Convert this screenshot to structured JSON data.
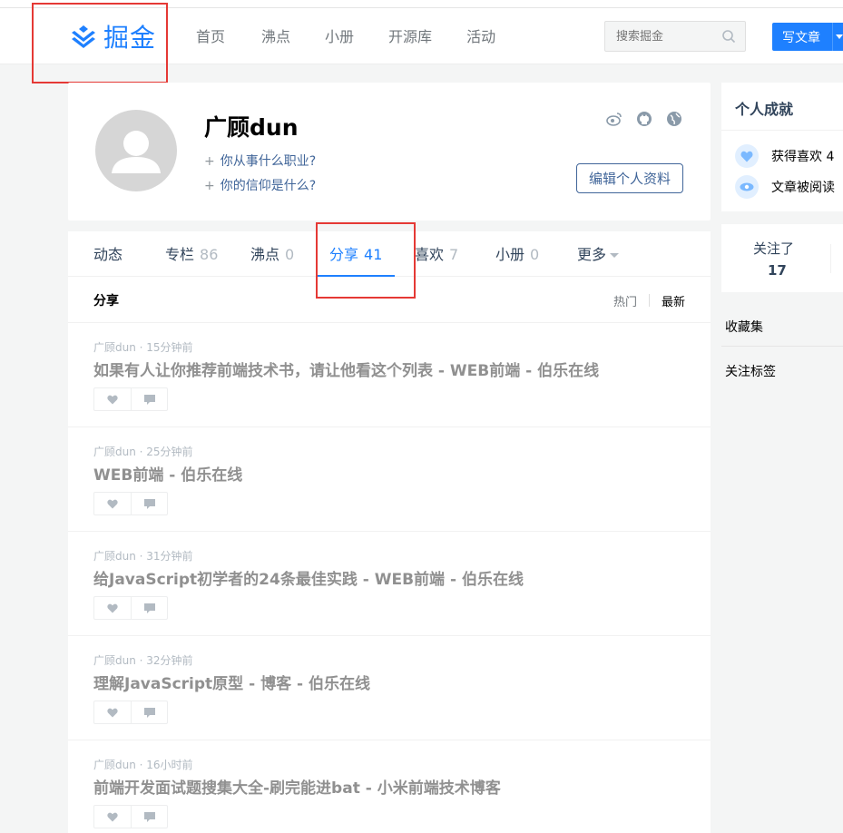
{
  "header": {
    "logo_text": "掘金",
    "nav": [
      "首页",
      "沸点",
      "小册",
      "开源库",
      "活动"
    ],
    "search_placeholder": "搜索掘金",
    "write_label": "写文章"
  },
  "profile": {
    "username": "广顾dun",
    "add_job": "你从事什么职业?",
    "add_belief": "你的信仰是什么?",
    "plus": "+",
    "edit_label": "编辑个人资料",
    "social_icons": [
      "weibo-icon",
      "github-icon",
      "globe-icon"
    ]
  },
  "tabs": [
    {
      "label": "动态",
      "count": ""
    },
    {
      "label": "专栏",
      "count": "86"
    },
    {
      "label": "沸点",
      "count": "0"
    },
    {
      "label": "分享",
      "count": "41",
      "active": true
    },
    {
      "label": "喜欢",
      "count": "7"
    },
    {
      "label": "小册",
      "count": "0"
    },
    {
      "label": "更多",
      "count": ""
    }
  ],
  "section": {
    "title": "分享",
    "sort_hot": "热门",
    "sort_new": "最新"
  },
  "entries": [
    {
      "meta": "广顾dun · 15分钟前",
      "title": "如果有人让你推荐前端技术书，请让他看这个列表 - WEB前端 - 伯乐在线"
    },
    {
      "meta": "广顾dun · 25分钟前",
      "title": "WEB前端 - 伯乐在线"
    },
    {
      "meta": "广顾dun · 31分钟前",
      "title": "给JavaScript初学者的24条最佳实践 - WEB前端 - 伯乐在线"
    },
    {
      "meta": "广顾dun · 32分钟前",
      "title": "理解JavaScript原型 - 博客 - 伯乐在线"
    },
    {
      "meta": "广顾dun · 16小时前",
      "title": "前端开发面试题搜集大全-刷完能进bat - 小米前端技术博客"
    }
  ],
  "sidebar": {
    "achievements_title": "个人成就",
    "likes_text": "获得喜欢 4",
    "reads_text": "文章被阅读",
    "following_label": "关注了",
    "following_count": "17",
    "collections": "收藏集",
    "tags": "关注标签"
  },
  "colors": {
    "brand": "#1e80ff",
    "highlight_box": "#e53935",
    "link": "#406599"
  }
}
